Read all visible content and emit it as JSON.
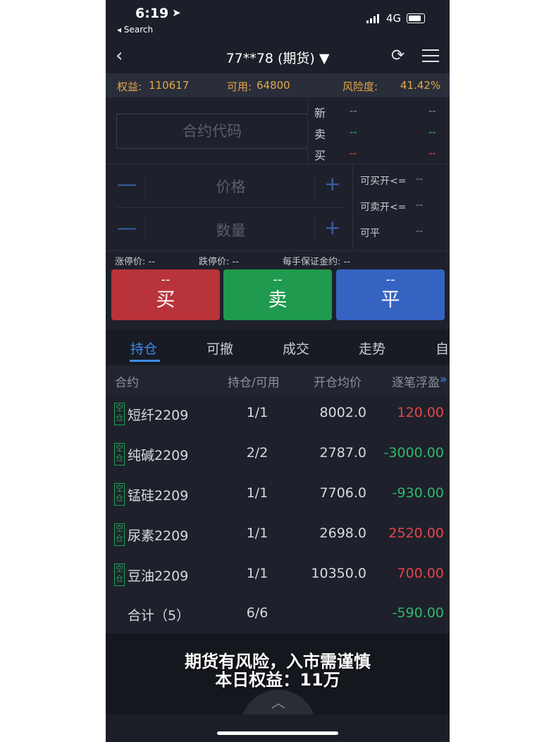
{
  "status": {
    "time": "6:19",
    "back_app": "◂ Search",
    "network": "4G"
  },
  "nav": {
    "title": "77**78 (期货) ▼"
  },
  "equity": {
    "equity_label": "权益:",
    "equity_value": "110617",
    "available_label": "可用:",
    "available_value": "64800",
    "risk_label": "风险度:",
    "risk_value": "41.42%"
  },
  "order": {
    "code_placeholder": "合约代码",
    "quotes": [
      {
        "label": "新",
        "a": "--",
        "b": "--"
      },
      {
        "label": "卖",
        "a": "--",
        "b": "--"
      },
      {
        "label": "买",
        "a": "--",
        "b": "--"
      }
    ],
    "price_placeholder": "价格",
    "qty_placeholder": "数量",
    "minus": "—",
    "plus": "+",
    "avail": [
      {
        "label": "可买开<=",
        "value": "--"
      },
      {
        "label": "可卖开<=",
        "value": "--"
      },
      {
        "label": "可平",
        "value": "--"
      }
    ],
    "limit_up": "涨停价: --",
    "limit_down": "跌停价: --",
    "margin": "每手保证金约: --",
    "buy": {
      "top": "--",
      "label": "买"
    },
    "sell": {
      "top": "--",
      "label": "卖"
    },
    "close": {
      "top": "--",
      "label": "平"
    }
  },
  "tabs": [
    "持仓",
    "可撤",
    "成交",
    "走势",
    "自"
  ],
  "table": {
    "headers": [
      "合约",
      "持仓/可用",
      "开仓均价",
      "逐笔浮盈"
    ],
    "more": "»",
    "tag": "空仓",
    "rows": [
      {
        "name": "短纤2209",
        "hold": "1/1",
        "price": "8002.0",
        "pnl": "120.00"
      },
      {
        "name": "纯碱2209",
        "hold": "2/2",
        "price": "2787.0",
        "pnl": "-3000.00"
      },
      {
        "name": "锰硅2209",
        "hold": "1/1",
        "price": "7706.0",
        "pnl": "-930.00"
      },
      {
        "name": "尿素2209",
        "hold": "1/1",
        "price": "2698.0",
        "pnl": "2520.00"
      },
      {
        "name": "豆油2209",
        "hold": "1/1",
        "price": "10350.0",
        "pnl": "700.00"
      }
    ],
    "total": {
      "label": "合计（5）",
      "hold": "6/6",
      "pnl": "-590.00"
    }
  },
  "overlay": {
    "line1": "期货有风险，入市需谨慎",
    "line2": "本日权益：11万",
    "pull_up": "︿"
  },
  "colors": {
    "accent": "#3d8bf0",
    "buy": "#b8333a",
    "sell": "#1f9a4f",
    "close": "#3563c2",
    "equity_text": "#e4a64a"
  }
}
